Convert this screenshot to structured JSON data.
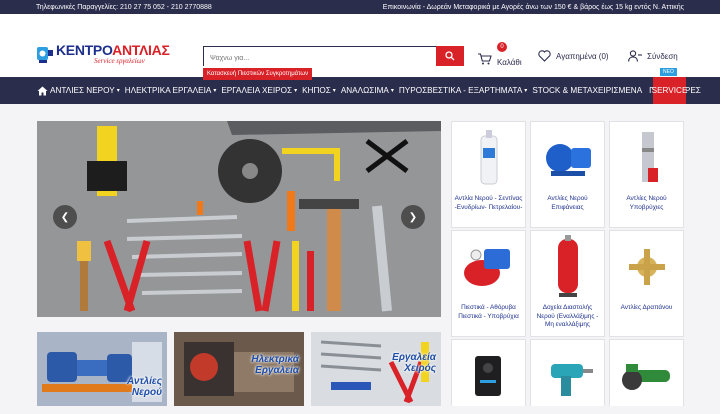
{
  "topbar": {
    "phones": "Τηλεφωνικές Παραγγελίες: 210 27 75 052 - 210 2770888",
    "notice": "Επικοινωνία - Δωρεάν Μεταφορικά με Αγορές άνω των 150 € & βάρος έως 15 kg εντός Ν. Αττικής"
  },
  "header": {
    "logo_main_a": "ΚΕΝΤΡΟ",
    "logo_main_b": "ΑΝΤΛΙΑΣ",
    "logo_sub": "Service εργαλείων",
    "search_placeholder": "Ψάχνω για...",
    "promo": "Κατασκευή Πιεστικών Συγκροτημάτων",
    "cart_label": "Καλάθι",
    "cart_count": "0",
    "wishlist_label": "Αγαπημένα (0)",
    "login_label": "Σύνδεση"
  },
  "nav": {
    "items": [
      {
        "label": "ΑΝΤΛΙΕΣ ΝΕΡΟΥ",
        "caret": "▾"
      },
      {
        "label": "ΗΛΕΚΤΡΙΚΑ ΕΡΓΑΛΕΙΑ",
        "caret": "▾"
      },
      {
        "label": "ΕΡΓΑΛΕΙΑ ΧΕΙΡΟΣ",
        "caret": "▾"
      },
      {
        "label": "ΚΗΠΟΣ",
        "caret": "▾"
      },
      {
        "label": "ΑΝΑΛΩΣΙΜΑ",
        "caret": "▾"
      },
      {
        "label": "ΠΥΡΟΣΒΕΣΤΙΚΑ - ΕΞΑΡΤΗΜΑΤΑ",
        "caret": "▾"
      },
      {
        "label": "STOCK & ΜΕΤΑΧΕΙΡΙΣΜΕΝΑ",
        "caret": ""
      },
      {
        "label": "ΠΡΟΣΦΟΡΕΣ",
        "caret": ""
      }
    ],
    "service": "SERVICE",
    "new_badge": "ΝΕΟ"
  },
  "banners": [
    {
      "label": "Αντλίες\nΝερού"
    },
    {
      "label": "Ηλεκτρικά\nΕργαλεία"
    },
    {
      "label": "Εργαλεία\nΧειρός"
    }
  ],
  "products": [
    {
      "name": "Αντλία Νερού - Σεντίνας -Ενυδρίων- Πετρελαίου-"
    },
    {
      "name": "Αντλίες Νερού Επιφάνειας"
    },
    {
      "name": "Αντλίες Νερού Υποβρύχιες"
    },
    {
      "name": "Πιεστικά - Αθόρυβα Πιεστικά - Υποβρύχια"
    },
    {
      "name": "Δοχεία Διαστολής Νερού (Εναλλάξιμης - Μη εναλλάξιμης"
    },
    {
      "name": "Αντλίες Δραπάνου"
    },
    {
      "name": ""
    },
    {
      "name": ""
    },
    {
      "name": ""
    }
  ]
}
